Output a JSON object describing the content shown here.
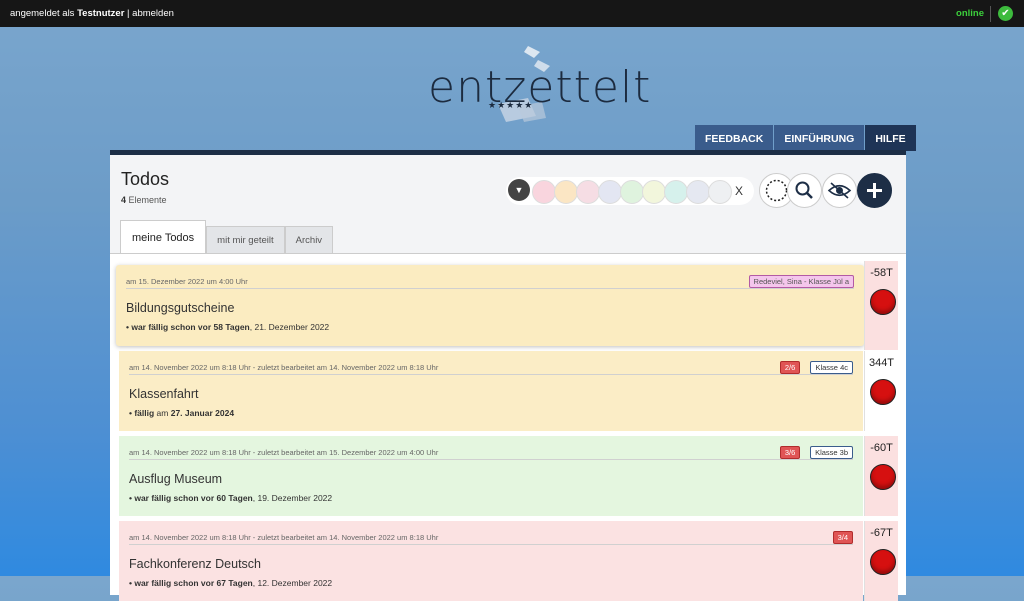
{
  "topbar": {
    "login_prefix": "angemeldet als ",
    "user": "Testnutzer",
    "separator": " | ",
    "logout": "abmelden",
    "status": "online",
    "status_color": "#3ccf3c"
  },
  "logo": {
    "word": "entzettelt",
    "stars": "★★★★★"
  },
  "nav": {
    "feedback": "FEEDBACK",
    "intro": "EINFÜHRUNG",
    "help": "HILFE"
  },
  "page": {
    "title": "Todos",
    "count": "4",
    "count_suffix": " Elemente"
  },
  "filters": {
    "colors": [
      "#f9d5de",
      "#fbe6c4",
      "#f6dde4",
      "#e3e6f2",
      "#dff3de",
      "#f2f6dc",
      "#d6f1ec",
      "#e5e8f1",
      "#eef0f2"
    ],
    "clear": "X"
  },
  "tabs": {
    "mine": "meine Todos",
    "shared": "mit mir geteilt",
    "archive": "Archiv"
  },
  "todos": [
    {
      "meta": "am 15. Dezember 2022 um 4:00 Uhr",
      "name": "Bildungsgutscheine",
      "due_prefix": "• war fällig schon vor 58 Tagen",
      "due_suffix": ", 21. Dezember 2022",
      "tags": [
        "Redeviel, Sina - Klasse Jül a"
      ],
      "days": "-58T",
      "bg": "#fbecc1",
      "side_bg": "#fbe0e0"
    },
    {
      "meta": "am 14. November 2022 um 8:18 Uhr - zuletzt bearbeitet am 14. November 2022 um 8:18 Uhr",
      "name": "Klassenfahrt",
      "due_prefix": "• fällig",
      "due_mid": " am ",
      "due_bold": "27. Januar 2024",
      "tags": [
        "2/6",
        "Klasse 4c"
      ],
      "days": "344T",
      "bg": "#fbedc6",
      "side_bg": "#ffffff"
    },
    {
      "meta": "am 14. November 2022 um 8:18 Uhr - zuletzt bearbeitet am 15. Dezember 2022 um 4:00 Uhr",
      "name": "Ausflug Museum",
      "due_prefix": "• war fällig schon vor 60 Tagen",
      "due_suffix": ", 19. Dezember 2022",
      "tags": [
        "3/6",
        "Klasse 3b"
      ],
      "days": "-60T",
      "bg": "#e4f6df",
      "side_bg": "#fbe0e0"
    },
    {
      "meta": "am 14. November 2022 um 8:18 Uhr - zuletzt bearbeitet am 14. November 2022 um 8:18 Uhr",
      "name": "Fachkonferenz Deutsch",
      "due_prefix": "• war fällig schon vor 67 Tagen",
      "due_suffix": ", 12. Dezember 2022",
      "tags": [
        "3/4"
      ],
      "days": "-67T",
      "bg": "#fbe2e2",
      "side_bg": "#fbe0e0"
    }
  ]
}
